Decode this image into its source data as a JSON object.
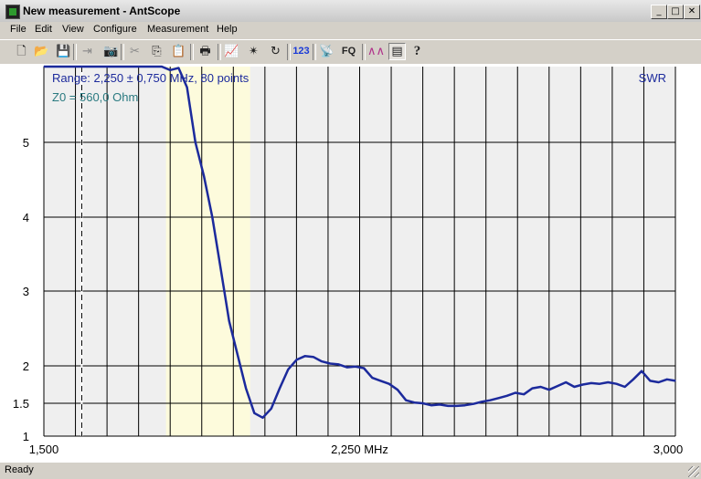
{
  "window": {
    "title": "New measurement - AntScope",
    "buttons": [
      {
        "name": "minimize",
        "glyph": "_"
      },
      {
        "name": "maximize",
        "glyph": "□"
      },
      {
        "name": "close",
        "glyph": "✕"
      }
    ]
  },
  "menu": [
    "File",
    "Edit",
    "View",
    "Configure",
    "Measurement",
    "Help"
  ],
  "toolbar": {
    "buttons": [
      {
        "name": "new-icon",
        "glyph": "🗋",
        "state": "normal"
      },
      {
        "name": "open-icon",
        "glyph": "📂",
        "state": "normal"
      },
      {
        "name": "save-icon",
        "glyph": "💾",
        "state": "normal"
      },
      {
        "name": "export-icon",
        "glyph": "⇥",
        "state": "disabled"
      },
      {
        "name": "camera-icon",
        "glyph": "📷",
        "state": "normal"
      },
      {
        "name": "cut-icon",
        "glyph": "✂",
        "state": "disabled"
      },
      {
        "name": "copy-icon",
        "glyph": "⎘",
        "state": "normal"
      },
      {
        "name": "paste-icon",
        "glyph": "📋",
        "state": "normal"
      },
      {
        "name": "print-icon",
        "glyph": "🖶",
        "state": "normal"
      },
      {
        "name": "chart-icon",
        "glyph": "📈",
        "state": "normal"
      },
      {
        "name": "scan-icon",
        "glyph": "✴",
        "state": "normal"
      },
      {
        "name": "refresh-icon",
        "glyph": "↻",
        "state": "normal"
      },
      {
        "name": "numeric-icon",
        "glyph": "123",
        "state": "normal"
      },
      {
        "name": "antenna-icon",
        "glyph": "📡",
        "state": "normal"
      },
      {
        "name": "fq-icon",
        "glyph": "FQ",
        "state": "normal"
      },
      {
        "name": "graph-wave-icon",
        "glyph": "∧∧",
        "state": "normal"
      },
      {
        "name": "document-icon",
        "glyph": "▤",
        "state": "pressed"
      },
      {
        "name": "help-icon",
        "glyph": "?",
        "state": "normal"
      }
    ]
  },
  "chart_data": {
    "type": "line",
    "title": "",
    "info_lines": [
      "Range: 2,250 ± 0,750 MHz, 80 points",
      "Z0 = 560,0 Ohm"
    ],
    "parameter_label": "SWR",
    "x_tick_labels": [
      "1,500",
      "2,250 MHz",
      "3,000"
    ],
    "y_tick_labels": [
      "5",
      "4",
      "3",
      "2",
      "1.5",
      "1"
    ],
    "xlim": [
      1.5,
      3.0
    ],
    "y_scale": "swr",
    "grid": true,
    "marker_x": 1.59,
    "highlight_band": [
      1.79,
      1.99
    ],
    "series": [
      {
        "color": "#1c2a9c",
        "x": [
          1.5,
          1.52,
          1.54,
          1.56,
          1.58,
          1.6,
          1.62,
          1.64,
          1.66,
          1.68,
          1.7,
          1.72,
          1.74,
          1.76,
          1.78,
          1.8,
          1.82,
          1.84,
          1.86,
          1.88,
          1.9,
          1.92,
          1.94,
          1.96,
          1.98,
          2.0,
          2.02,
          2.04,
          2.06,
          2.08,
          2.1,
          2.12,
          2.14,
          2.16,
          2.18,
          2.2,
          2.22,
          2.24,
          2.26,
          2.28,
          2.3,
          2.32,
          2.34,
          2.36,
          2.38,
          2.4,
          2.42,
          2.44,
          2.46,
          2.48,
          2.5,
          2.52,
          2.54,
          2.56,
          2.58,
          2.6,
          2.62,
          2.64,
          2.66,
          2.68,
          2.7,
          2.72,
          2.74,
          2.76,
          2.78,
          2.8,
          2.82,
          2.84,
          2.86,
          2.88,
          2.9,
          2.92,
          2.94,
          2.96,
          2.98,
          3.0
        ],
        "y": [
          6.1,
          6.1,
          6.1,
          6.1,
          6.1,
          6.1,
          6.1,
          6.1,
          6.1,
          6.1,
          6.1,
          6.1,
          6.1,
          6.1,
          6.1,
          6.05,
          6.08,
          5.8,
          5.0,
          4.55,
          4.0,
          3.3,
          2.6,
          2.15,
          1.7,
          1.35,
          1.28,
          1.42,
          1.7,
          1.95,
          2.08,
          2.13,
          2.12,
          2.06,
          2.03,
          2.02,
          1.98,
          1.99,
          1.97,
          1.84,
          1.8,
          1.76,
          1.68,
          1.54,
          1.51,
          1.5,
          1.47,
          1.48,
          1.46,
          1.46,
          1.47,
          1.49,
          1.52,
          1.54,
          1.57,
          1.6,
          1.64,
          1.62,
          1.7,
          1.72,
          1.68,
          1.73,
          1.78,
          1.72,
          1.75,
          1.77,
          1.76,
          1.78,
          1.76,
          1.72,
          1.82,
          1.93,
          1.8,
          1.78,
          1.82,
          1.8
        ]
      }
    ]
  },
  "status": "Ready"
}
